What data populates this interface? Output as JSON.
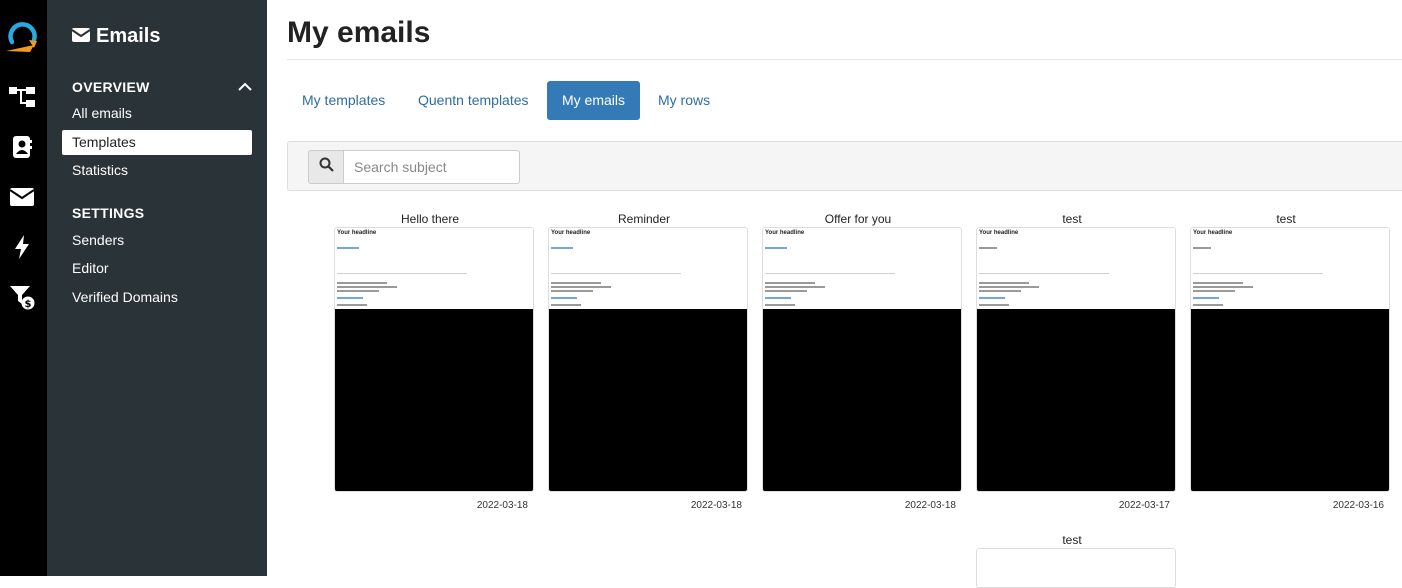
{
  "sidebar": {
    "title": "Emails",
    "sections": [
      {
        "label": "OVERVIEW",
        "items": [
          {
            "label": "All emails",
            "active": false
          },
          {
            "label": "Templates",
            "active": true
          },
          {
            "label": "Statistics",
            "active": false
          }
        ]
      },
      {
        "label": "SETTINGS",
        "items": [
          {
            "label": "Senders",
            "active": false
          },
          {
            "label": "Editor",
            "active": false
          },
          {
            "label": "Verified Domains",
            "active": false
          }
        ]
      }
    ]
  },
  "rail": {
    "icons": [
      "app-logo",
      "funnel-flow-icon",
      "contacts-icon",
      "envelope-icon",
      "bolt-icon",
      "pricing-filter-icon"
    ]
  },
  "main": {
    "title": "My emails",
    "tabs": [
      {
        "label": "My templates",
        "active": false
      },
      {
        "label": "Quentn templates",
        "active": false
      },
      {
        "label": "My emails",
        "active": true
      },
      {
        "label": "My rows",
        "active": false
      }
    ],
    "search": {
      "placeholder": "Search subject",
      "value": ""
    },
    "cards": [
      {
        "name": "Hello there",
        "date": "2022-03-18",
        "preview_headline": "Your headline"
      },
      {
        "name": "Reminder",
        "date": "2022-03-18",
        "preview_headline": "Your headline"
      },
      {
        "name": "Offer for you",
        "date": "2022-03-18",
        "preview_headline": "Your headline"
      },
      {
        "name": "test",
        "date": "2022-03-17",
        "preview_headline": "Your headline"
      },
      {
        "name": "test",
        "date": "2022-03-16",
        "preview_headline": "Your headline"
      },
      {
        "name": "test",
        "date": "",
        "preview_headline": ""
      }
    ]
  },
  "colors": {
    "rail": "#000000",
    "sidebar": "#2a3338",
    "accent": "#337ab7",
    "logo_blue": "#29a9e0",
    "logo_orange": "#f39a1e"
  }
}
